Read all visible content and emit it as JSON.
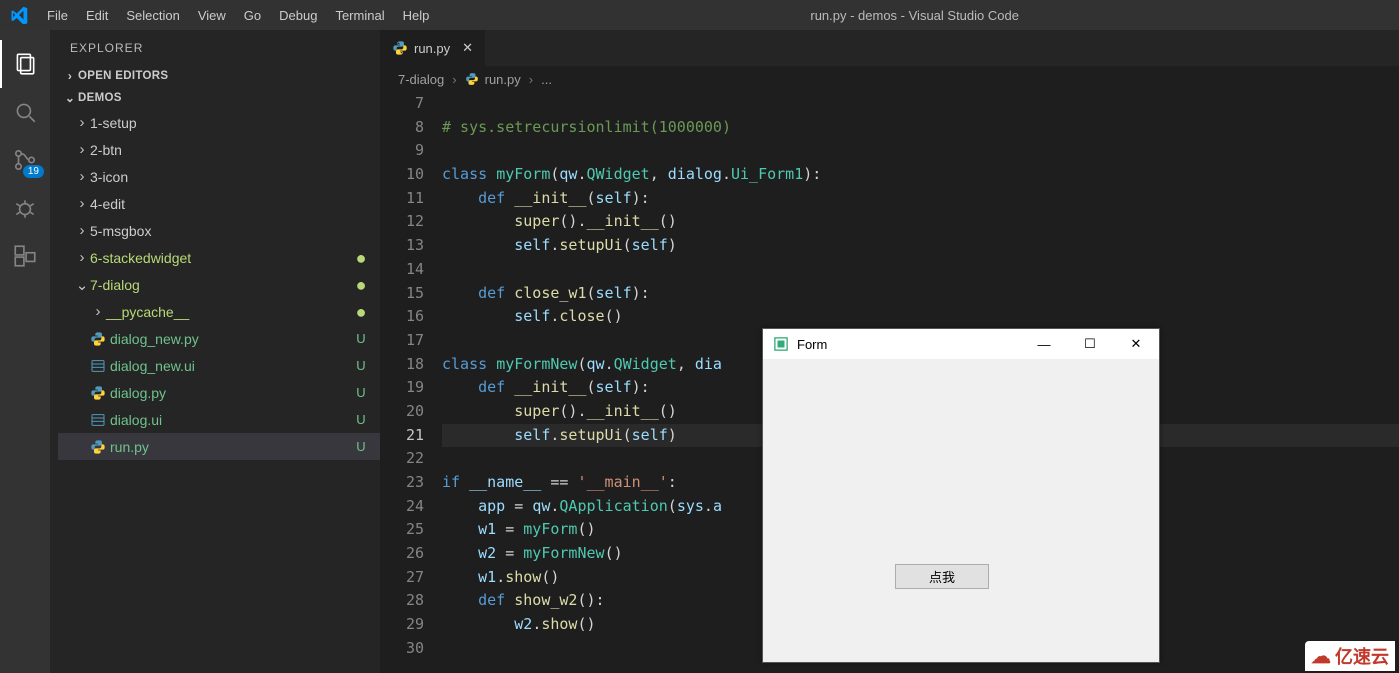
{
  "window_title": "run.py - demos - Visual Studio Code",
  "menubar": [
    "File",
    "Edit",
    "Selection",
    "View",
    "Go",
    "Debug",
    "Terminal",
    "Help"
  ],
  "activity": {
    "scm_badge": "19"
  },
  "sidebar": {
    "title": "EXPLORER",
    "sections": {
      "open_editors": "OPEN EDITORS",
      "workspace": "DEMOS"
    },
    "folders": [
      {
        "name": "1-setup"
      },
      {
        "name": "2-btn"
      },
      {
        "name": "3-icon"
      },
      {
        "name": "4-edit"
      },
      {
        "name": "5-msgbox"
      },
      {
        "name": "6-stackedwidget",
        "state": "modified",
        "dotOnly": true
      },
      {
        "name": "7-dialog",
        "state": "modified",
        "dotOnly": true,
        "expanded": true
      }
    ],
    "dialog_children": [
      {
        "name": "__pycache__",
        "type": "folder",
        "state": "modified",
        "dotOnly": true
      },
      {
        "name": "dialog_new.py",
        "type": "py",
        "state": "untracked",
        "badge": "U"
      },
      {
        "name": "dialog_new.ui",
        "type": "ui",
        "state": "untracked",
        "badge": "U"
      },
      {
        "name": "dialog.py",
        "type": "py",
        "state": "untracked",
        "badge": "U"
      },
      {
        "name": "dialog.ui",
        "type": "ui",
        "state": "untracked",
        "badge": "U"
      },
      {
        "name": "run.py",
        "type": "py",
        "state": "untracked",
        "badge": "U",
        "selected": true
      }
    ]
  },
  "tab": {
    "filename": "run.py"
  },
  "breadcrumb": {
    "folder": "7-dialog",
    "file": "run.py",
    "tail": "..."
  },
  "editor": {
    "first_line_no": 7,
    "current_line_no": 21,
    "lines": [
      {
        "n": 7,
        "seg": [
          [
            " ",
            "pn"
          ]
        ]
      },
      {
        "n": 8,
        "seg": [
          [
            "# sys.setrecursionlimit(1000000)",
            "com"
          ]
        ]
      },
      {
        "n": 9,
        "seg": [
          [
            " ",
            "pn"
          ]
        ]
      },
      {
        "n": 10,
        "seg": [
          [
            "class ",
            "kw"
          ],
          [
            "myForm",
            "cls"
          ],
          [
            "(",
            "pn"
          ],
          [
            "qw",
            "var"
          ],
          [
            ".",
            "pn"
          ],
          [
            "QWidget",
            "cls"
          ],
          [
            ", ",
            "pn"
          ],
          [
            "dialog",
            "var"
          ],
          [
            ".",
            "pn"
          ],
          [
            "Ui_Form1",
            "cls"
          ],
          [
            "):",
            "pn"
          ]
        ]
      },
      {
        "n": 11,
        "seg": [
          [
            "    ",
            "pn"
          ],
          [
            "def ",
            "kw"
          ],
          [
            "__init__",
            "dund"
          ],
          [
            "(",
            "pn"
          ],
          [
            "self",
            "self"
          ],
          [
            "):",
            "pn"
          ]
        ]
      },
      {
        "n": 12,
        "seg": [
          [
            "        ",
            "pn"
          ],
          [
            "super",
            "fn"
          ],
          [
            "().",
            "pn"
          ],
          [
            "__init__",
            "dund"
          ],
          [
            "()",
            "pn"
          ]
        ]
      },
      {
        "n": 13,
        "seg": [
          [
            "        ",
            "pn"
          ],
          [
            "self",
            "self"
          ],
          [
            ".",
            "pn"
          ],
          [
            "setupUi",
            "fn"
          ],
          [
            "(",
            "pn"
          ],
          [
            "self",
            "self"
          ],
          [
            ")",
            "pn"
          ]
        ]
      },
      {
        "n": 14,
        "seg": [
          [
            " ",
            "pn"
          ]
        ]
      },
      {
        "n": 15,
        "seg": [
          [
            "    ",
            "pn"
          ],
          [
            "def ",
            "kw"
          ],
          [
            "close_w1",
            "fn"
          ],
          [
            "(",
            "pn"
          ],
          [
            "self",
            "self"
          ],
          [
            "):",
            "pn"
          ]
        ]
      },
      {
        "n": 16,
        "seg": [
          [
            "        ",
            "pn"
          ],
          [
            "self",
            "self"
          ],
          [
            ".",
            "pn"
          ],
          [
            "close",
            "fn"
          ],
          [
            "()",
            "pn"
          ]
        ]
      },
      {
        "n": 17,
        "seg": [
          [
            " ",
            "pn"
          ]
        ]
      },
      {
        "n": 18,
        "seg": [
          [
            "class ",
            "kw"
          ],
          [
            "myFormNew",
            "cls"
          ],
          [
            "(",
            "pn"
          ],
          [
            "qw",
            "var"
          ],
          [
            ".",
            "pn"
          ],
          [
            "QWidget",
            "cls"
          ],
          [
            ", ",
            "pn"
          ],
          [
            "dia",
            "var"
          ]
        ]
      },
      {
        "n": 19,
        "seg": [
          [
            "    ",
            "pn"
          ],
          [
            "def ",
            "kw"
          ],
          [
            "__init__",
            "dund"
          ],
          [
            "(",
            "pn"
          ],
          [
            "self",
            "self"
          ],
          [
            "):",
            "pn"
          ]
        ]
      },
      {
        "n": 20,
        "seg": [
          [
            "        ",
            "pn"
          ],
          [
            "super",
            "fn"
          ],
          [
            "().",
            "pn"
          ],
          [
            "__init__",
            "dund"
          ],
          [
            "()",
            "pn"
          ]
        ]
      },
      {
        "n": 21,
        "seg": [
          [
            "        ",
            "pn"
          ],
          [
            "self",
            "self"
          ],
          [
            ".",
            "pn"
          ],
          [
            "setupUi",
            "fn"
          ],
          [
            "(",
            "pn"
          ],
          [
            "self",
            "self"
          ],
          [
            ")",
            "pn"
          ]
        ],
        "hl": true
      },
      {
        "n": 22,
        "seg": [
          [
            " ",
            "pn"
          ]
        ]
      },
      {
        "n": 23,
        "seg": [
          [
            "if ",
            "kw"
          ],
          [
            "__name__",
            "var"
          ],
          [
            " == ",
            "op"
          ],
          [
            "'__main__'",
            "str"
          ],
          [
            ":",
            "pn"
          ]
        ]
      },
      {
        "n": 24,
        "seg": [
          [
            "    ",
            "pn"
          ],
          [
            "app",
            "var"
          ],
          [
            " = ",
            "op"
          ],
          [
            "qw",
            "var"
          ],
          [
            ".",
            "pn"
          ],
          [
            "QApplication",
            "cls"
          ],
          [
            "(",
            "pn"
          ],
          [
            "sys",
            "var"
          ],
          [
            ".",
            "pn"
          ],
          [
            "a",
            "var"
          ]
        ]
      },
      {
        "n": 25,
        "seg": [
          [
            "    ",
            "pn"
          ],
          [
            "w1",
            "var"
          ],
          [
            " = ",
            "op"
          ],
          [
            "myForm",
            "cls"
          ],
          [
            "()",
            "pn"
          ]
        ]
      },
      {
        "n": 26,
        "seg": [
          [
            "    ",
            "pn"
          ],
          [
            "w2",
            "var"
          ],
          [
            " = ",
            "op"
          ],
          [
            "myFormNew",
            "cls"
          ],
          [
            "()",
            "pn"
          ]
        ]
      },
      {
        "n": 27,
        "seg": [
          [
            "    ",
            "pn"
          ],
          [
            "w1",
            "var"
          ],
          [
            ".",
            "pn"
          ],
          [
            "show",
            "fn"
          ],
          [
            "()",
            "pn"
          ]
        ]
      },
      {
        "n": 28,
        "seg": [
          [
            "    ",
            "pn"
          ],
          [
            "def ",
            "kw"
          ],
          [
            "show_w2",
            "fn"
          ],
          [
            "():",
            "pn"
          ]
        ]
      },
      {
        "n": 29,
        "seg": [
          [
            "        ",
            "pn"
          ],
          [
            "w2",
            "var"
          ],
          [
            ".",
            "pn"
          ],
          [
            "show",
            "fn"
          ],
          [
            "()",
            "pn"
          ]
        ]
      },
      {
        "n": 30,
        "seg": [
          [
            " ",
            "pn"
          ]
        ]
      }
    ]
  },
  "qt": {
    "title": "Form",
    "button": "点我"
  },
  "watermark": "亿速云"
}
